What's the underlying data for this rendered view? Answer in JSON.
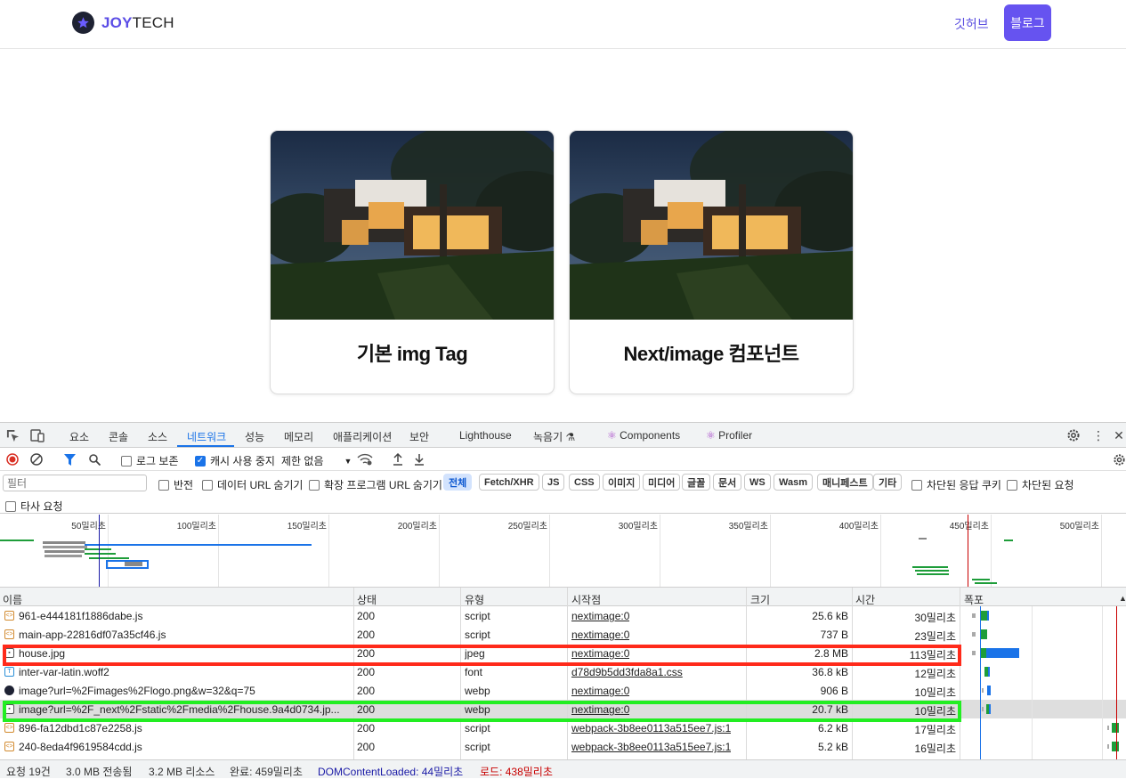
{
  "site": {
    "logo_accent": "JOY",
    "logo_rest": "TECH",
    "nav_link": "깃허브",
    "nav_button": "블로그",
    "cards": [
      {
        "title": "기본 img Tag"
      },
      {
        "title": "Next/image 컴포넌트"
      }
    ]
  },
  "devtools": {
    "tabs": [
      "요소",
      "콘솔",
      "소스",
      "네트워크",
      "성능",
      "메모리",
      "애플리케이션",
      "보안",
      "Lighthouse",
      "녹음기",
      "Components",
      "Profiler"
    ],
    "active_tab": "네트워크",
    "toolbar": {
      "preserve_log": "로그 보존",
      "disable_cache": "캐시 사용 중지",
      "disable_cache_checked": true,
      "throttle": "제한 없음"
    },
    "filter": {
      "placeholder": "필터",
      "invert": "반전",
      "hide_data_urls": "데이터 URL 숨기기",
      "hide_ext_urls": "확장 프로그램 URL 숨기기",
      "types": [
        "전체",
        "Fetch/XHR",
        "JS",
        "CSS",
        "이미지",
        "미디어",
        "글꼴",
        "문서",
        "WS",
        "Wasm",
        "매니페스트",
        "기타"
      ],
      "blocked_cookies": "차단된 응답 쿠키",
      "blocked_requests": "차단된 요청",
      "third_party": "타사 요청"
    },
    "overview_ticks": [
      "50밀리초",
      "100밀리초",
      "150밀리초",
      "200밀리초",
      "250밀리초",
      "300밀리초",
      "350밀리초",
      "400밀리초",
      "450밀리초",
      "500밀리초"
    ],
    "columns": [
      "이름",
      "상태",
      "유형",
      "시작점",
      "크기",
      "시간",
      "폭포"
    ],
    "rows": [
      {
        "name": "961-e444181f1886dabe.js",
        "status": "200",
        "type": "script",
        "initiator": "nextimage:0",
        "size": "25.6 kB",
        "time": "30밀리초",
        "icon": "script"
      },
      {
        "name": "main-app-22816df07a35cf46.js",
        "status": "200",
        "type": "script",
        "initiator": "nextimage:0",
        "size": "737 B",
        "time": "23밀리초",
        "icon": "script"
      },
      {
        "name": "house.jpg",
        "status": "200",
        "type": "jpeg",
        "initiator": "nextimage:0",
        "size": "2.8 MB",
        "time": "113밀리초",
        "icon": "image"
      },
      {
        "name": "inter-var-latin.woff2",
        "status": "200",
        "type": "font",
        "initiator": "d78d9b5dd3fda8a1.css",
        "size": "36.8 kB",
        "time": "12밀리초",
        "icon": "font"
      },
      {
        "name": "image?url=%2Fimages%2Flogo.png&w=32&q=75",
        "status": "200",
        "type": "webp",
        "initiator": "nextimage:0",
        "size": "906 B",
        "time": "10밀리초",
        "icon": "logo"
      },
      {
        "name": "image?url=%2F_next%2Fstatic%2Fmedia%2Fhouse.9a4d0734.jp...",
        "status": "200",
        "type": "webp",
        "initiator": "nextimage:0",
        "size": "20.7 kB",
        "time": "10밀리초",
        "icon": "image"
      },
      {
        "name": "896-fa12dbd1c87e2258.js",
        "status": "200",
        "type": "script",
        "initiator": "webpack-3b8ee0113a515ee7.js:1",
        "size": "6.2 kB",
        "time": "17밀리초",
        "icon": "script"
      },
      {
        "name": "240-8eda4f9619584cdd.js",
        "status": "200",
        "type": "script",
        "initiator": "webpack-3b8ee0113a515ee7.js:1",
        "size": "5.2 kB",
        "time": "16밀리초",
        "icon": "script"
      }
    ],
    "summary": {
      "requests": "요청 19건",
      "transferred": "3.0 MB 전송됨",
      "resources": "3.2 MB 리소스",
      "finish": "완료: 459밀리초",
      "dcl": "DOMContentLoaded: 44밀리초",
      "load": "로드: 438밀리초"
    },
    "colors": {
      "accent": "#1a73e8",
      "highlight_red": "#ff2a1a",
      "highlight_green": "#22ee22",
      "dcl": "#1a1aa6",
      "load": "#c80000"
    }
  }
}
